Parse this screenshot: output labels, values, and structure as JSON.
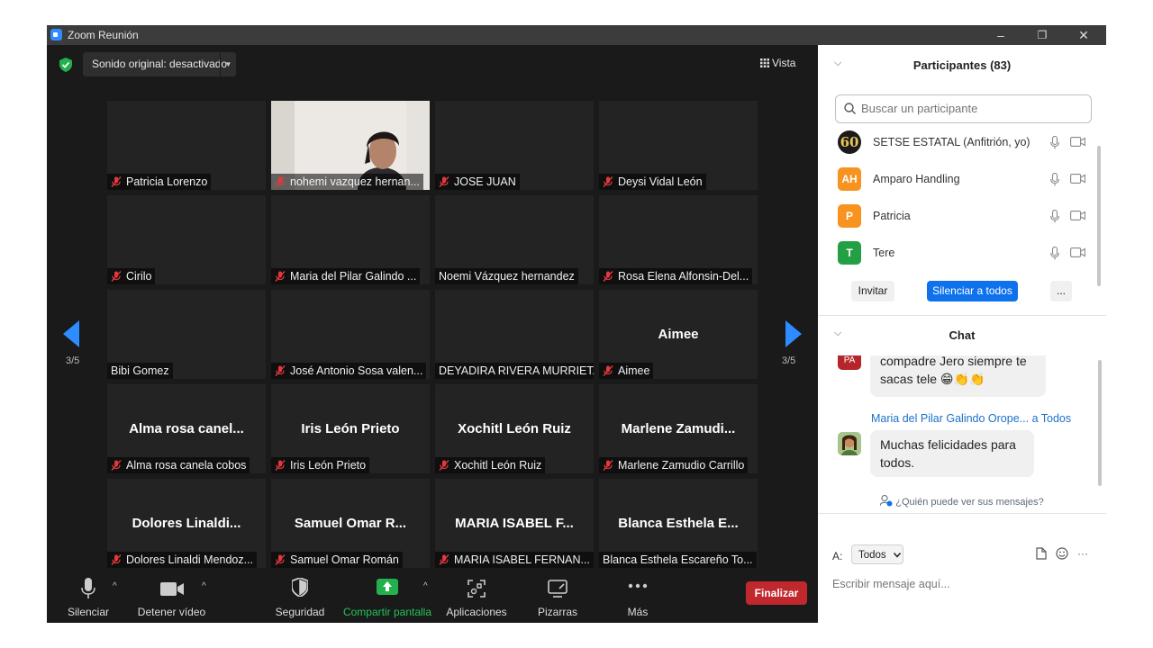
{
  "window": {
    "title": "Zoom Reunión",
    "controls": {
      "minimize": "–",
      "restore": "❐",
      "close": "✕"
    }
  },
  "meeting": {
    "original_sound": "Sonido original: desactivado",
    "view_label": "Vista",
    "page_indicator_left": "3/5",
    "page_indicator_right": "3/5",
    "tiles": [
      {
        "name": "Patricia Lorenzo",
        "muted": true,
        "big": ""
      },
      {
        "name": "nohemi vazquez hernan...",
        "muted": true,
        "big": "",
        "video": true
      },
      {
        "name": "JOSE JUAN",
        "muted": true,
        "big": ""
      },
      {
        "name": "Deysi Vidal León",
        "muted": true,
        "big": ""
      },
      {
        "name": "Cirilo",
        "muted": true,
        "big": ""
      },
      {
        "name": "Maria del Pilar Galindo ...",
        "muted": true,
        "big": ""
      },
      {
        "name": "Noemi Vázquez hernandez",
        "muted": false,
        "big": ""
      },
      {
        "name": "Rosa Elena Alfonsin-Del...",
        "muted": true,
        "big": ""
      },
      {
        "name": "Bibi Gomez",
        "muted": false,
        "big": ""
      },
      {
        "name": "José Antonio Sosa valen...",
        "muted": true,
        "big": ""
      },
      {
        "name": "DEYADIRA RIVERA MURRIETA",
        "muted": false,
        "big": ""
      },
      {
        "name": "Aimee",
        "muted": true,
        "big": "Aimee"
      },
      {
        "name": "Alma rosa canela cobos",
        "muted": true,
        "big": "Alma rosa canel..."
      },
      {
        "name": "Iris León Prieto",
        "muted": true,
        "big": "Iris León Prieto"
      },
      {
        "name": "Xochitl León Ruiz",
        "muted": true,
        "big": "Xochitl León Ruiz"
      },
      {
        "name": "Marlene Zamudio Carrillo",
        "muted": true,
        "big": "Marlene  Zamudi..."
      },
      {
        "name": "Dolores Linaldi Mendoz...",
        "muted": true,
        "big": "Dolores  Linaldi..."
      },
      {
        "name": "Samuel Omar Román",
        "muted": true,
        "big": "Samuel Omar R..."
      },
      {
        "name": "MARIA ISABEL FERNAN...",
        "muted": true,
        "big": "MARIA ISABEL F..."
      },
      {
        "name": "Blanca Esthela Escareño To...",
        "muted": false,
        "big": "Blanca Esthela E..."
      }
    ]
  },
  "toolbar": {
    "mute": "Silenciar",
    "stop_video": "Detener vídeo",
    "security": "Seguridad",
    "share_screen": "Compartir pantalla",
    "apps": "Aplicaciones",
    "whiteboards": "Pizarras",
    "more": "Más",
    "end": "Finalizar"
  },
  "participants": {
    "header": "Participantes (83)",
    "search_placeholder": "Buscar un participante",
    "list": [
      {
        "initials": "60",
        "name": "SETSE ESTATAL (Anfitrión, yo)",
        "color": "#1a1a1a"
      },
      {
        "initials": "AH",
        "name": "Amparo Handling",
        "color": "#f7931e"
      },
      {
        "initials": "P",
        "name": "Patricia",
        "color": "#f7931e"
      },
      {
        "initials": "T",
        "name": "Tere",
        "color": "#23a044"
      }
    ],
    "invite": "Invitar",
    "mute_all": "Silenciar a todos",
    "more": "..."
  },
  "chat": {
    "header": "Chat",
    "prev_avatar": "PA",
    "prev_message_line1": "compadre Jero siempre te",
    "prev_message_line2": "sacas tele 😁👏👏",
    "sender": "Maria del Pilar Galindo Orope...",
    "recipient": "a Todos",
    "message_line1": "Muchas felicidades para",
    "message_line2": "todos.",
    "who_can_see": "¿Quién puede ver sus mensajes?",
    "to_label": "A:",
    "to_value": "Todos",
    "compose_placeholder": "Escribir mensaje aquí...",
    "more": "···"
  }
}
